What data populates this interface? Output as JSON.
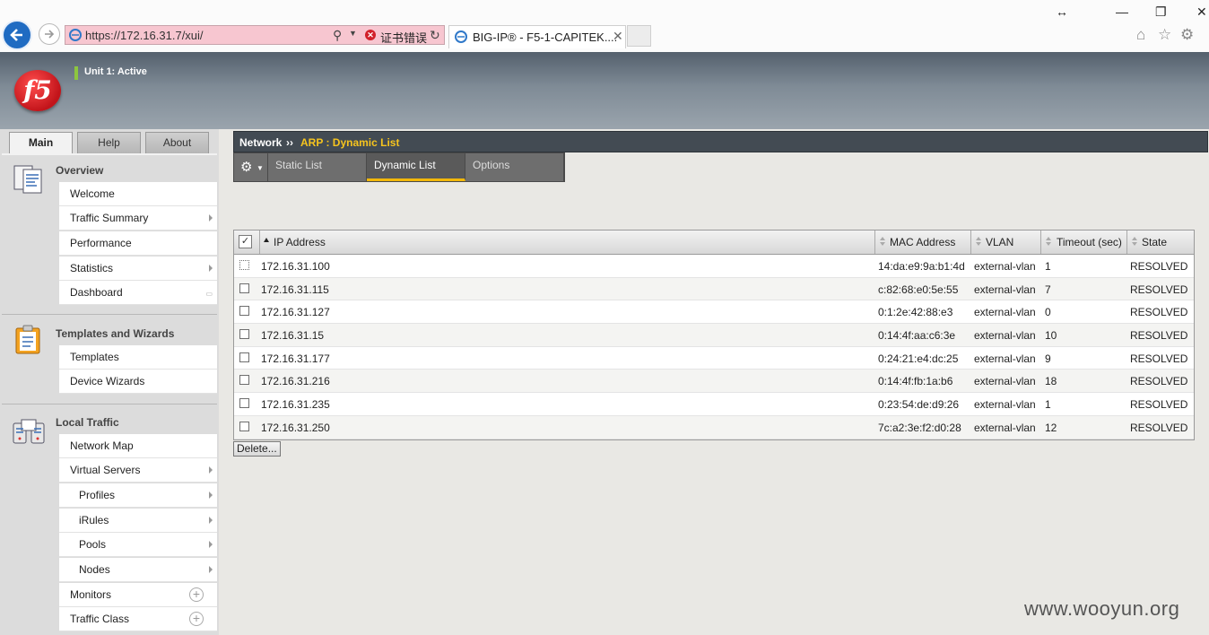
{
  "browser": {
    "url": "https://172.16.31.7/xui/",
    "cert_error": "证书错误",
    "tab_title": "BIG-IP® - F5-1-CAPITEK....",
    "window_controls": {
      "resize": "↔",
      "minimize": "—",
      "restore": "❐",
      "close": "✕"
    }
  },
  "header": {
    "unit_status": "Unit 1: Active",
    "logo_text": "f5"
  },
  "nav_tabs": [
    "Main",
    "Help",
    "About"
  ],
  "nav": {
    "overview": {
      "title": "Overview",
      "items": [
        "Welcome",
        "Traffic Summary",
        "Performance",
        "Statistics",
        "Dashboard"
      ]
    },
    "templates": {
      "title": "Templates and Wizards",
      "items": [
        "Templates",
        "Device Wizards"
      ]
    },
    "local_traffic": {
      "title": "Local Traffic",
      "items": [
        "Network Map",
        "Virtual Servers",
        "Profiles",
        "iRules",
        "Pools",
        "Nodes",
        "Monitors",
        "Traffic Class"
      ]
    }
  },
  "breadcrumb": {
    "section": "Network",
    "separator": "››",
    "page": "ARP : Dynamic List"
  },
  "subtabs": [
    "Static List",
    "Dynamic List",
    "Options"
  ],
  "table": {
    "columns": [
      "IP Address",
      "MAC Address",
      "VLAN",
      "Timeout (sec)",
      "State"
    ],
    "rows": [
      [
        "172.16.31.100",
        "14:da:e9:9a:b1:4d",
        "external-vlan",
        "1",
        "RESOLVED"
      ],
      [
        "172.16.31.115",
        "c:82:68:e0:5e:55",
        "external-vlan",
        "7",
        "RESOLVED"
      ],
      [
        "172.16.31.127",
        "0:1:2e:42:88:e3",
        "external-vlan",
        "0",
        "RESOLVED"
      ],
      [
        "172.16.31.15",
        "0:14:4f:aa:c6:3e",
        "external-vlan",
        "10",
        "RESOLVED"
      ],
      [
        "172.16.31.177",
        "0:24:21:e4:dc:25",
        "external-vlan",
        "9",
        "RESOLVED"
      ],
      [
        "172.16.31.216",
        "0:14:4f:fb:1a:b6",
        "external-vlan",
        "18",
        "RESOLVED"
      ],
      [
        "172.16.31.235",
        "0:23:54:de:d9:26",
        "external-vlan",
        "1",
        "RESOLVED"
      ],
      [
        "172.16.31.250",
        "7c:a2:3e:f2:d0:28",
        "external-vlan",
        "12",
        "RESOLVED"
      ]
    ]
  },
  "delete_label": "Delete...",
  "watermark": "www.wooyun.org"
}
